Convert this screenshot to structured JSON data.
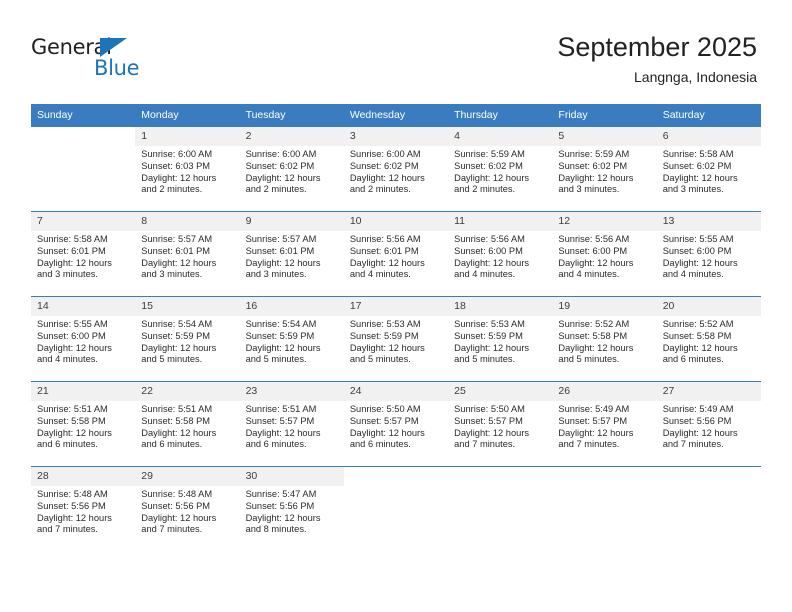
{
  "brand": {
    "name_part1": "General",
    "name_part2": "Blue",
    "accent_color": "#1b75bb"
  },
  "header": {
    "title": "September 2025",
    "subtitle": "Langnga, Indonesia",
    "header_bg_color": "#3a7cc0",
    "daynum_bg_color": "#f1f1f1"
  },
  "weekdays": [
    "Sunday",
    "Monday",
    "Tuesday",
    "Wednesday",
    "Thursday",
    "Friday",
    "Saturday"
  ],
  "weeks": [
    [
      {
        "day": "",
        "sunrise": "",
        "sunset": "",
        "daylight": "",
        "daylight2": ""
      },
      {
        "day": "1",
        "sunrise": "Sunrise: 6:00 AM",
        "sunset": "Sunset: 6:03 PM",
        "daylight": "Daylight: 12 hours",
        "daylight2": "and 2 minutes."
      },
      {
        "day": "2",
        "sunrise": "Sunrise: 6:00 AM",
        "sunset": "Sunset: 6:02 PM",
        "daylight": "Daylight: 12 hours",
        "daylight2": "and 2 minutes."
      },
      {
        "day": "3",
        "sunrise": "Sunrise: 6:00 AM",
        "sunset": "Sunset: 6:02 PM",
        "daylight": "Daylight: 12 hours",
        "daylight2": "and 2 minutes."
      },
      {
        "day": "4",
        "sunrise": "Sunrise: 5:59 AM",
        "sunset": "Sunset: 6:02 PM",
        "daylight": "Daylight: 12 hours",
        "daylight2": "and 2 minutes."
      },
      {
        "day": "5",
        "sunrise": "Sunrise: 5:59 AM",
        "sunset": "Sunset: 6:02 PM",
        "daylight": "Daylight: 12 hours",
        "daylight2": "and 3 minutes."
      },
      {
        "day": "6",
        "sunrise": "Sunrise: 5:58 AM",
        "sunset": "Sunset: 6:02 PM",
        "daylight": "Daylight: 12 hours",
        "daylight2": "and 3 minutes."
      }
    ],
    [
      {
        "day": "7",
        "sunrise": "Sunrise: 5:58 AM",
        "sunset": "Sunset: 6:01 PM",
        "daylight": "Daylight: 12 hours",
        "daylight2": "and 3 minutes."
      },
      {
        "day": "8",
        "sunrise": "Sunrise: 5:57 AM",
        "sunset": "Sunset: 6:01 PM",
        "daylight": "Daylight: 12 hours",
        "daylight2": "and 3 minutes."
      },
      {
        "day": "9",
        "sunrise": "Sunrise: 5:57 AM",
        "sunset": "Sunset: 6:01 PM",
        "daylight": "Daylight: 12 hours",
        "daylight2": "and 3 minutes."
      },
      {
        "day": "10",
        "sunrise": "Sunrise: 5:56 AM",
        "sunset": "Sunset: 6:01 PM",
        "daylight": "Daylight: 12 hours",
        "daylight2": "and 4 minutes."
      },
      {
        "day": "11",
        "sunrise": "Sunrise: 5:56 AM",
        "sunset": "Sunset: 6:00 PM",
        "daylight": "Daylight: 12 hours",
        "daylight2": "and 4 minutes."
      },
      {
        "day": "12",
        "sunrise": "Sunrise: 5:56 AM",
        "sunset": "Sunset: 6:00 PM",
        "daylight": "Daylight: 12 hours",
        "daylight2": "and 4 minutes."
      },
      {
        "day": "13",
        "sunrise": "Sunrise: 5:55 AM",
        "sunset": "Sunset: 6:00 PM",
        "daylight": "Daylight: 12 hours",
        "daylight2": "and 4 minutes."
      }
    ],
    [
      {
        "day": "14",
        "sunrise": "Sunrise: 5:55 AM",
        "sunset": "Sunset: 6:00 PM",
        "daylight": "Daylight: 12 hours",
        "daylight2": "and 4 minutes."
      },
      {
        "day": "15",
        "sunrise": "Sunrise: 5:54 AM",
        "sunset": "Sunset: 5:59 PM",
        "daylight": "Daylight: 12 hours",
        "daylight2": "and 5 minutes."
      },
      {
        "day": "16",
        "sunrise": "Sunrise: 5:54 AM",
        "sunset": "Sunset: 5:59 PM",
        "daylight": "Daylight: 12 hours",
        "daylight2": "and 5 minutes."
      },
      {
        "day": "17",
        "sunrise": "Sunrise: 5:53 AM",
        "sunset": "Sunset: 5:59 PM",
        "daylight": "Daylight: 12 hours",
        "daylight2": "and 5 minutes."
      },
      {
        "day": "18",
        "sunrise": "Sunrise: 5:53 AM",
        "sunset": "Sunset: 5:59 PM",
        "daylight": "Daylight: 12 hours",
        "daylight2": "and 5 minutes."
      },
      {
        "day": "19",
        "sunrise": "Sunrise: 5:52 AM",
        "sunset": "Sunset: 5:58 PM",
        "daylight": "Daylight: 12 hours",
        "daylight2": "and 5 minutes."
      },
      {
        "day": "20",
        "sunrise": "Sunrise: 5:52 AM",
        "sunset": "Sunset: 5:58 PM",
        "daylight": "Daylight: 12 hours",
        "daylight2": "and 6 minutes."
      }
    ],
    [
      {
        "day": "21",
        "sunrise": "Sunrise: 5:51 AM",
        "sunset": "Sunset: 5:58 PM",
        "daylight": "Daylight: 12 hours",
        "daylight2": "and 6 minutes."
      },
      {
        "day": "22",
        "sunrise": "Sunrise: 5:51 AM",
        "sunset": "Sunset: 5:58 PM",
        "daylight": "Daylight: 12 hours",
        "daylight2": "and 6 minutes."
      },
      {
        "day": "23",
        "sunrise": "Sunrise: 5:51 AM",
        "sunset": "Sunset: 5:57 PM",
        "daylight": "Daylight: 12 hours",
        "daylight2": "and 6 minutes."
      },
      {
        "day": "24",
        "sunrise": "Sunrise: 5:50 AM",
        "sunset": "Sunset: 5:57 PM",
        "daylight": "Daylight: 12 hours",
        "daylight2": "and 6 minutes."
      },
      {
        "day": "25",
        "sunrise": "Sunrise: 5:50 AM",
        "sunset": "Sunset: 5:57 PM",
        "daylight": "Daylight: 12 hours",
        "daylight2": "and 7 minutes."
      },
      {
        "day": "26",
        "sunrise": "Sunrise: 5:49 AM",
        "sunset": "Sunset: 5:57 PM",
        "daylight": "Daylight: 12 hours",
        "daylight2": "and 7 minutes."
      },
      {
        "day": "27",
        "sunrise": "Sunrise: 5:49 AM",
        "sunset": "Sunset: 5:56 PM",
        "daylight": "Daylight: 12 hours",
        "daylight2": "and 7 minutes."
      }
    ],
    [
      {
        "day": "28",
        "sunrise": "Sunrise: 5:48 AM",
        "sunset": "Sunset: 5:56 PM",
        "daylight": "Daylight: 12 hours",
        "daylight2": "and 7 minutes."
      },
      {
        "day": "29",
        "sunrise": "Sunrise: 5:48 AM",
        "sunset": "Sunset: 5:56 PM",
        "daylight": "Daylight: 12 hours",
        "daylight2": "and 7 minutes."
      },
      {
        "day": "30",
        "sunrise": "Sunrise: 5:47 AM",
        "sunset": "Sunset: 5:56 PM",
        "daylight": "Daylight: 12 hours",
        "daylight2": "and 8 minutes."
      },
      {
        "day": "",
        "sunrise": "",
        "sunset": "",
        "daylight": "",
        "daylight2": ""
      },
      {
        "day": "",
        "sunrise": "",
        "sunset": "",
        "daylight": "",
        "daylight2": ""
      },
      {
        "day": "",
        "sunrise": "",
        "sunset": "",
        "daylight": "",
        "daylight2": ""
      },
      {
        "day": "",
        "sunrise": "",
        "sunset": "",
        "daylight": "",
        "daylight2": ""
      }
    ]
  ]
}
